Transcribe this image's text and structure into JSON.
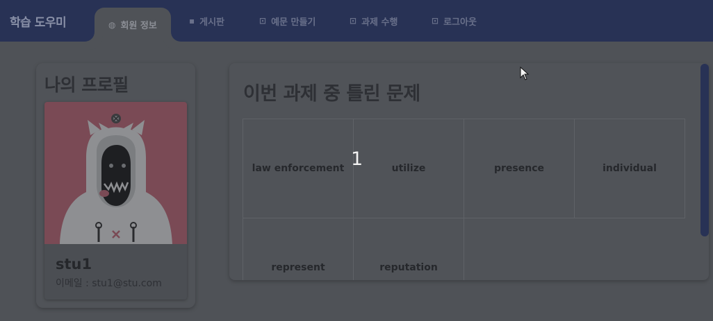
{
  "nav": {
    "brand": "학습 도우미",
    "tabs": [
      {
        "label": "회원 정보",
        "icon": "user-circle-icon",
        "active": true
      },
      {
        "label": "게시판",
        "icon": "board-icon",
        "active": false
      },
      {
        "label": "예문 만들기",
        "icon": "sentence-icon",
        "active": false
      },
      {
        "label": "과제 수행",
        "icon": "task-icon",
        "active": false
      },
      {
        "label": "로그아웃",
        "icon": "logout-icon",
        "active": false
      }
    ]
  },
  "profile": {
    "title": "나의 프로필",
    "username": "stu1",
    "email": "이메일 : stu1@stu.com"
  },
  "wrong_problems": {
    "title": "이번 과제 중 틀린 문제",
    "words": [
      "law enforcement",
      "utilize",
      "presence",
      "individual",
      "represent",
      "reputation"
    ]
  },
  "overlay_number": "1",
  "colors": {
    "nav_bg": "#283255",
    "avatar_bg": "#c86a7a",
    "scrollbar": "#283255"
  }
}
